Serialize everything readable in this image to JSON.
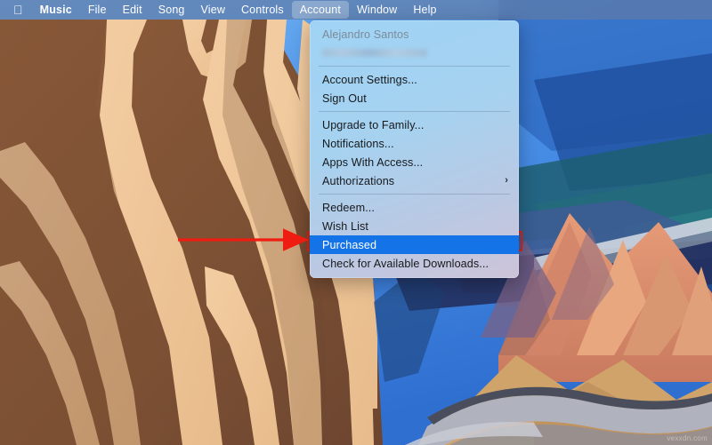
{
  "menubar": {
    "apple_icon": "apple-logo-icon",
    "items": [
      {
        "label": "Music",
        "bold": true,
        "active": false
      },
      {
        "label": "File",
        "bold": false,
        "active": false
      },
      {
        "label": "Edit",
        "bold": false,
        "active": false
      },
      {
        "label": "Song",
        "bold": false,
        "active": false
      },
      {
        "label": "View",
        "bold": false,
        "active": false
      },
      {
        "label": "Controls",
        "bold": false,
        "active": false
      },
      {
        "label": "Account",
        "bold": false,
        "active": true
      },
      {
        "label": "Window",
        "bold": false,
        "active": false
      },
      {
        "label": "Help",
        "bold": false,
        "active": false
      }
    ]
  },
  "account_menu": {
    "account_name": "Alejandro Santos",
    "account_email_redacted": "",
    "items": [
      {
        "label": "Account Settings...",
        "selected": false,
        "submenu": false
      },
      {
        "label": "Sign Out",
        "selected": false,
        "submenu": false
      },
      {
        "label": "Upgrade to Family...",
        "selected": false,
        "submenu": false
      },
      {
        "label": "Notifications...",
        "selected": false,
        "submenu": false
      },
      {
        "label": "Apps With Access...",
        "selected": false,
        "submenu": false
      },
      {
        "label": "Authorizations",
        "selected": false,
        "submenu": true
      },
      {
        "label": "Redeem...",
        "selected": false,
        "submenu": false
      },
      {
        "label": "Wish List",
        "selected": false,
        "submenu": false
      },
      {
        "label": "Purchased",
        "selected": true,
        "submenu": false
      },
      {
        "label": "Check for Available Downloads...",
        "selected": false,
        "submenu": false
      }
    ],
    "submenu_arrow_glyph": "›"
  },
  "annotation": {
    "arrow_color": "#ee1c11",
    "highlight_border_color": "#ee1c11",
    "target_label": "Purchased"
  },
  "watermark": {
    "text": "vexxdn.com"
  },
  "colors": {
    "menu_selection_blue": "#1473e6",
    "menubar_tint": "#5f7ba8",
    "wallpaper_sky": "#4a94e8",
    "wallpaper_rock_dark": "#8a5a3c",
    "wallpaper_rock_light": "#f0c79a"
  }
}
